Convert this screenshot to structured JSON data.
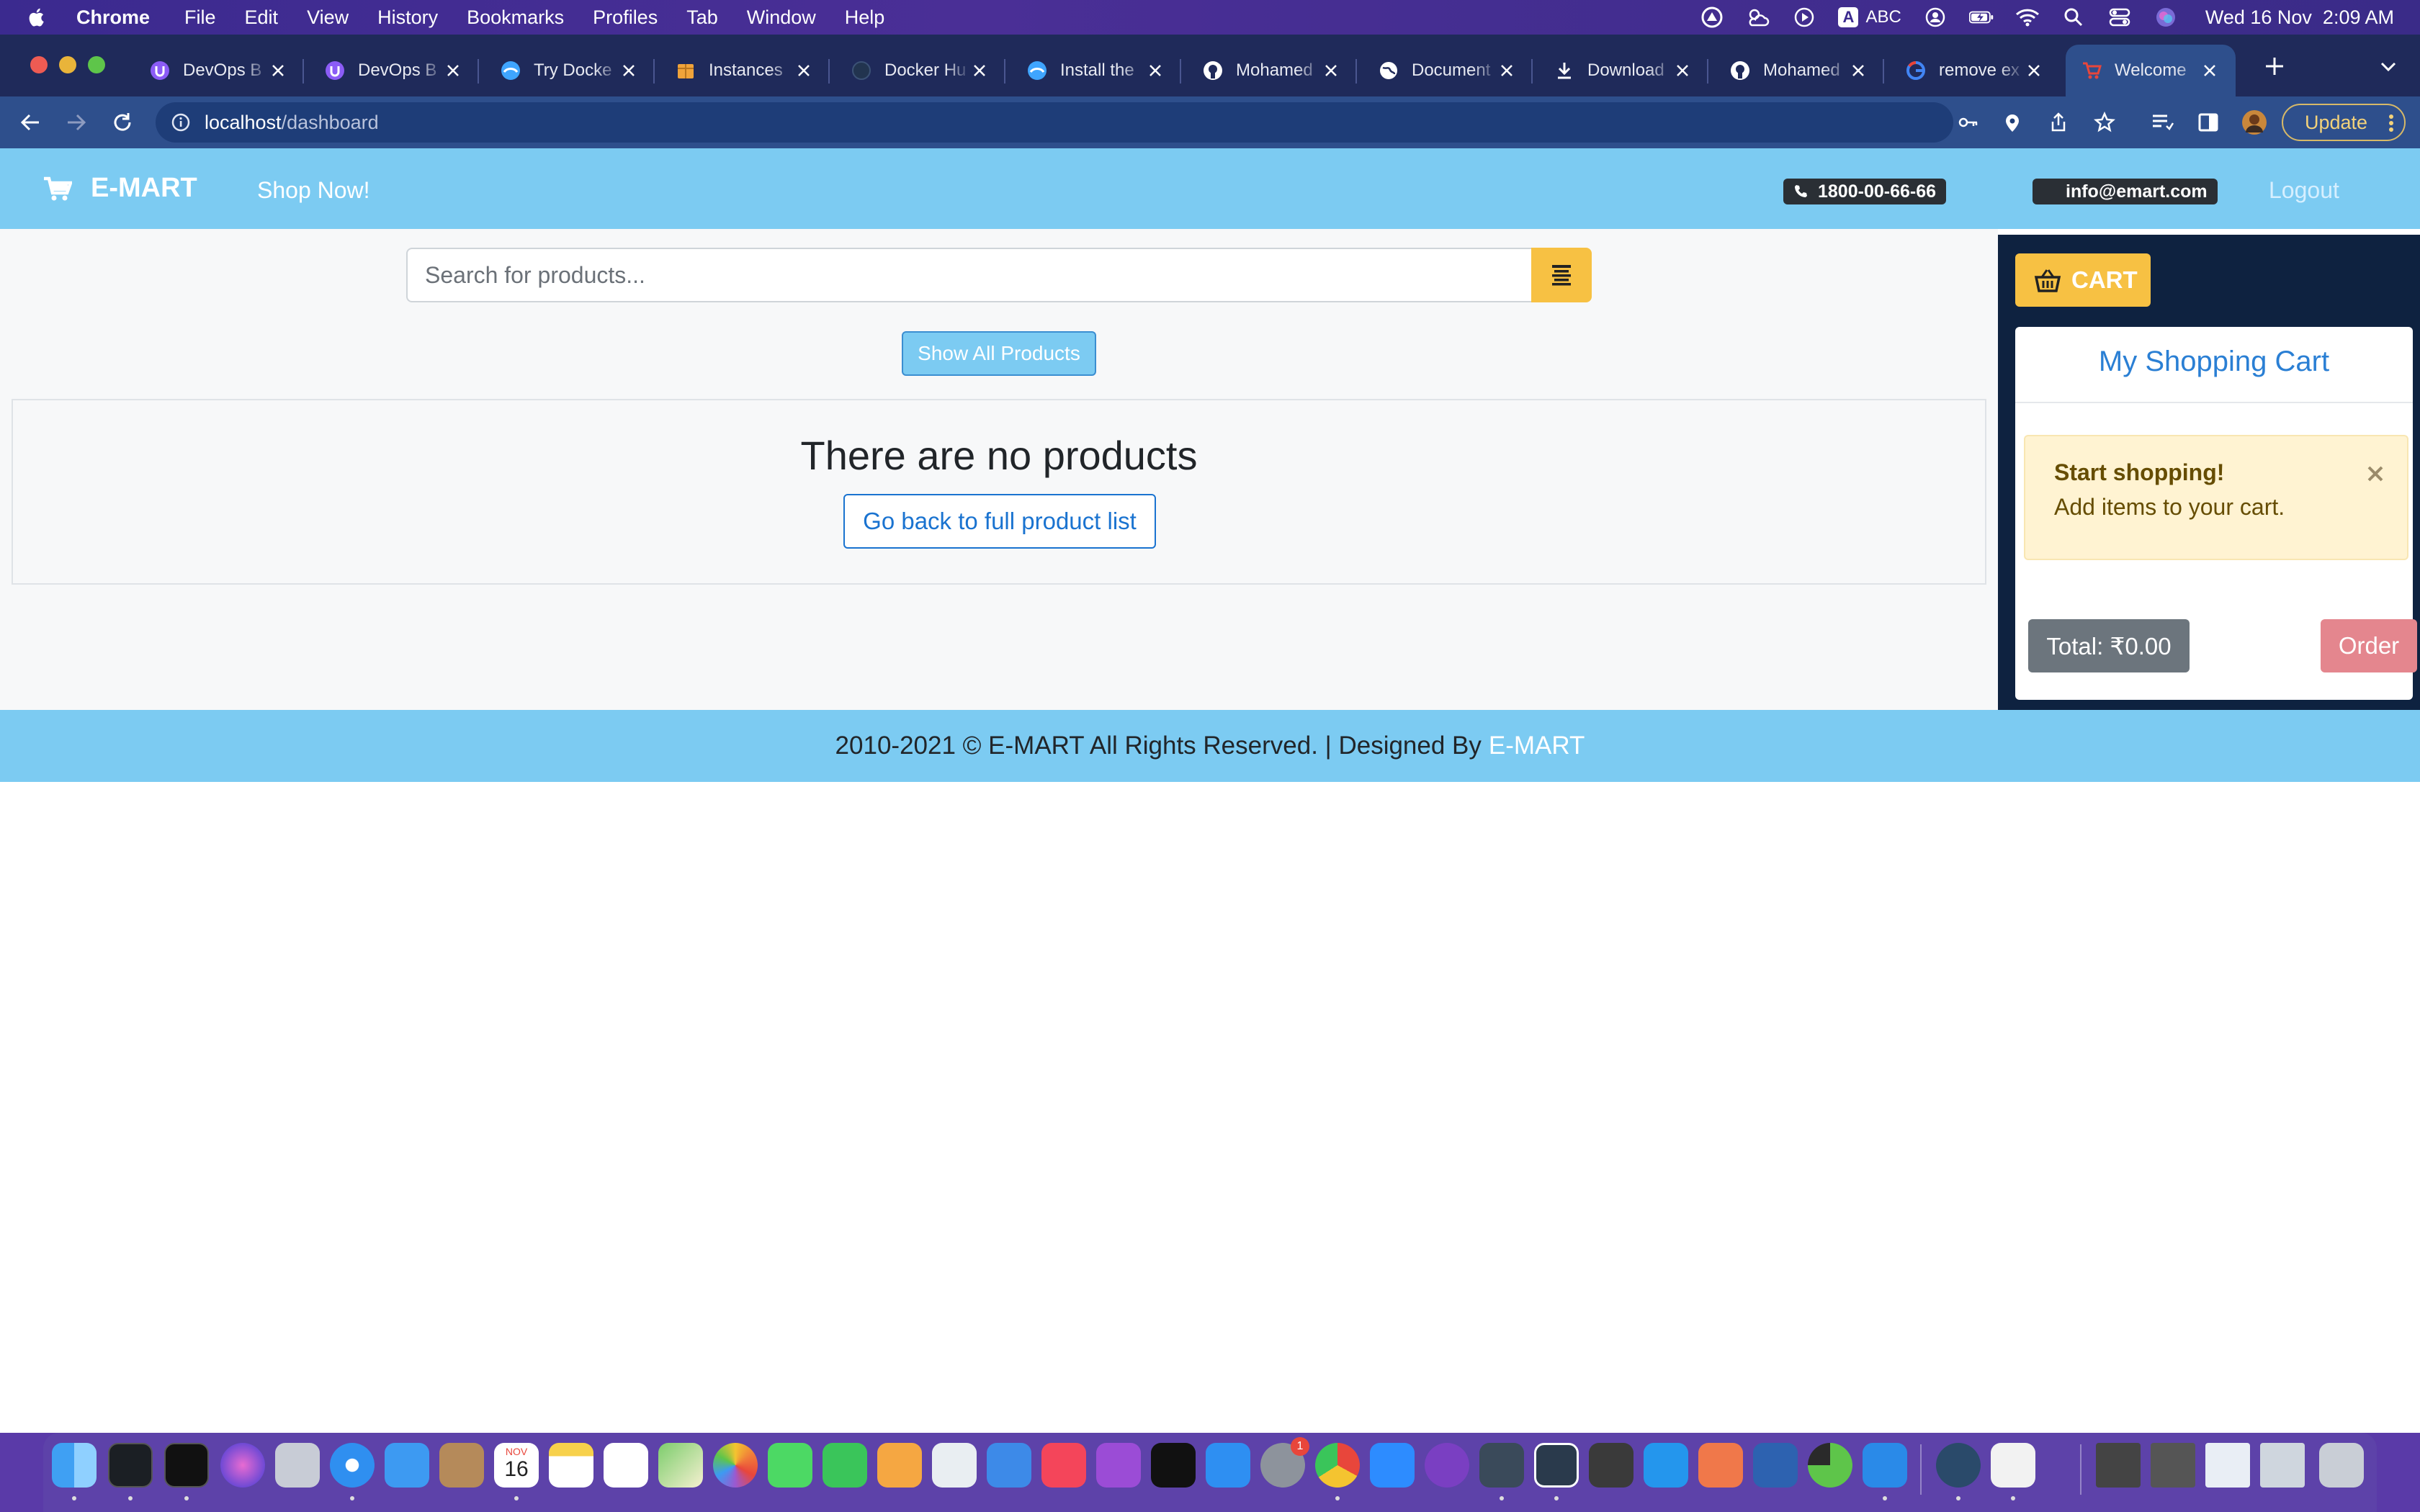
{
  "menubar": {
    "app": "Chrome",
    "items": [
      "File",
      "Edit",
      "View",
      "History",
      "Bookmarks",
      "Profiles",
      "Tab",
      "Window",
      "Help"
    ],
    "input_label": "ABC",
    "clock": "Wed 16 Nov  2:09 AM"
  },
  "tabs": [
    {
      "title": "DevOps B",
      "icon": "devops-icon",
      "color": "#8b5cf6"
    },
    {
      "title": "DevOps B",
      "icon": "devops-icon",
      "color": "#8b5cf6"
    },
    {
      "title": "Try Docke",
      "icon": "docker-labs-icon",
      "color": "#3fa5ff"
    },
    {
      "title": "Instances",
      "icon": "aws-box-icon",
      "color": "#f0a33a"
    },
    {
      "title": "Docker Hu",
      "icon": "docker-hub-icon",
      "color": "#22344f"
    },
    {
      "title": "Install the",
      "icon": "docker-docs-icon",
      "color": "#3fa5ff"
    },
    {
      "title": "Mohamed",
      "icon": "github-icon",
      "color": "#ffffff"
    },
    {
      "title": "Document",
      "icon": "globe-icon",
      "color": "#ffffff"
    },
    {
      "title": "Download",
      "icon": "download-icon",
      "color": "#ffffff"
    },
    {
      "title": "Mohamed",
      "icon": "github-icon",
      "color": "#ffffff"
    },
    {
      "title": "remove ex",
      "icon": "google-icon",
      "color": "#ffffff"
    },
    {
      "title": "Welcome",
      "icon": "emart-cart-icon",
      "color": "#e8463b",
      "active": true
    }
  ],
  "address": {
    "host": "localhost",
    "path": "/dashboard"
  },
  "toolbar": {
    "update_label": "Update"
  },
  "site": {
    "brand": "E-MART",
    "shop_now": "Shop Now!",
    "phone": "1800-00-66-66",
    "email": "info@emart.com",
    "logout": "Logout",
    "accent": "#7ccbf2",
    "yellow": "#f7c143"
  },
  "search": {
    "placeholder": "Search for products..."
  },
  "main": {
    "show_all_label": "Show All Products",
    "empty_title": "There are no products",
    "back_label": "Go back to full product list"
  },
  "cart": {
    "button_label": "CART",
    "title": "My Shopping Cart",
    "alert_title": "Start shopping!",
    "alert_message": "Add items to your cart.",
    "total_label": "Total: ₹0.00",
    "order_label": "Order"
  },
  "footer": {
    "text": "2010-2021 © E-MART All Rights Reserved. | Designed By",
    "link": "E-MART"
  },
  "dock": {
    "calendar_month": "NOV",
    "calendar_day": "16",
    "badge_count": "1"
  }
}
